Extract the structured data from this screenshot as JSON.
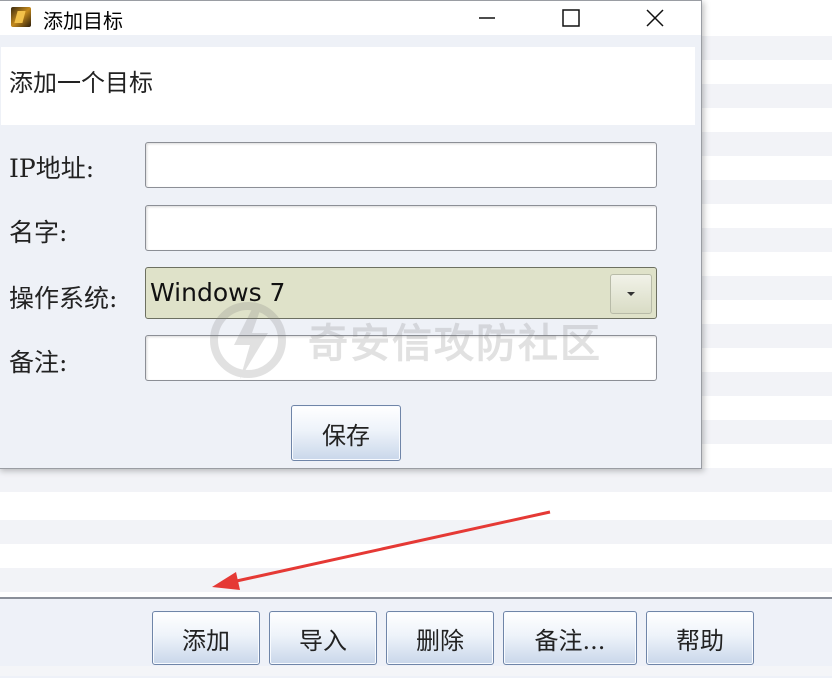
{
  "dialog": {
    "title": "添加目标",
    "header": "添加一个目标",
    "fields": {
      "ip_label": "IP地址:",
      "ip_value": "",
      "name_label": "名字:",
      "name_value": "",
      "os_label": "操作系统:",
      "os_value": "Windows 7",
      "note_label": "备注:",
      "note_value": ""
    },
    "save_label": "保存"
  },
  "toolbar": {
    "add_label": "添加",
    "import_label": "导入",
    "delete_label": "删除",
    "note_label": "备注...",
    "help_label": "帮助"
  },
  "watermark": {
    "text": "奇安信攻防社区"
  },
  "icons": {
    "app": "app-logo-icon",
    "minimize": "minimize-icon",
    "maximize": "maximize-icon",
    "close": "close-icon",
    "dropdown": "chevron-down-icon",
    "annotation": "red-arrow-annotation"
  },
  "colors": {
    "annotation_arrow": "#e53935",
    "select_bg": "#dfe2c9",
    "button_gradient_end": "#c9d7ea"
  }
}
